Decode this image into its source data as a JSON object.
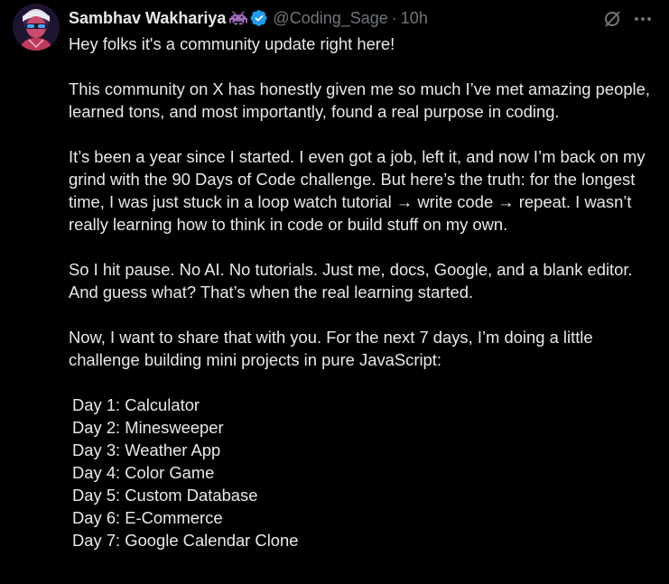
{
  "author": {
    "display_name": "Sambhav Wakhariya",
    "handle": "@Coding_Sage",
    "separator": "·",
    "time": "10h",
    "emoji_icon": "space-invader-icon",
    "verified_icon": "verified-badge-icon"
  },
  "actions": {
    "grok_icon": "grok-slash-icon",
    "more_icon": "more-dots-icon"
  },
  "post": {
    "p1": "Hey folks it's a community update right here!",
    "p2": "This community on X has honestly given me so much I’ve met amazing people, learned tons, and most importantly, found a real purpose in coding.",
    "p3": "It’s been a year since I started. I even got a job, left it, and now I’m back on my grind with the 90 Days of Code challenge. But here’s the truth: for the longest time, I was just stuck in a loop watch tutorial → write code → repeat. I wasn’t really learning how to think in code or build stuff on my own.",
    "p4": "So I hit pause. No AI. No tutorials. Just me, docs, Google, and a blank editor. And guess what? That’s when the real learning started.",
    "p5": "Now, I want to share that with you. For the next 7 days, I’m doing a little challenge building mini projects in pure JavaScript:",
    "days": [
      "Day 1: Calculator",
      "Day 2: Minesweeper",
      "Day 3: Weather App",
      "Day 4: Color Game",
      "Day 5: Custom Database",
      "Day 6: E-Commerce",
      "Day 7: Google Calendar Clone"
    ]
  },
  "colors": {
    "background": "#000000",
    "text": "#e7e9ea",
    "secondary": "#71767b",
    "verified": "#1d9bf0",
    "emoji": "#a970c8"
  }
}
